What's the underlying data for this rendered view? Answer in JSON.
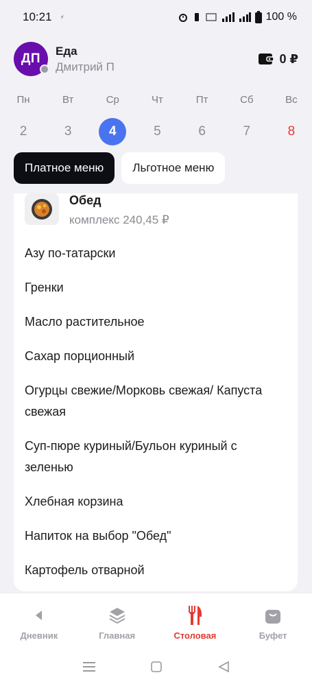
{
  "status_bar": {
    "time": "10:21",
    "small_icon": "⚡",
    "battery": "100 %"
  },
  "header": {
    "avatar_initials": "ДП",
    "title": "Еда",
    "subtitle": "Дмитрий П",
    "balance": "0 ₽"
  },
  "week": {
    "days": [
      {
        "name": "Пн",
        "num": "2"
      },
      {
        "name": "Вт",
        "num": "3"
      },
      {
        "name": "Ср",
        "num": "4"
      },
      {
        "name": "Чт",
        "num": "5"
      },
      {
        "name": "Пт",
        "num": "6"
      },
      {
        "name": "Сб",
        "num": "7"
      },
      {
        "name": "Вс",
        "num": "8"
      }
    ],
    "selected_color": "#4a74ef",
    "weekend_color": "#e53935"
  },
  "tabs": {
    "paid": "Платное меню",
    "discount": "Льготное меню"
  },
  "dish": {
    "title": "Обед",
    "subtitle": "комплекс 240,45 ₽",
    "items": [
      "Азу по-татарски",
      "Гренки",
      "Масло растительное",
      "Сахар порционный",
      "Огурцы свежие/Морковь свежая/ Капуста свежая",
      "Суп-пюре куриный/Бульон куриный с зеленью",
      "Хлебная корзина",
      "Напиток на выбор \"Обед\"",
      "Картофель отварной"
    ]
  },
  "bottom_nav": {
    "diary": "Дневник",
    "main": "Главная",
    "canteen": "Столовая",
    "buffet": "Буфет",
    "active_color": "#e53935"
  }
}
